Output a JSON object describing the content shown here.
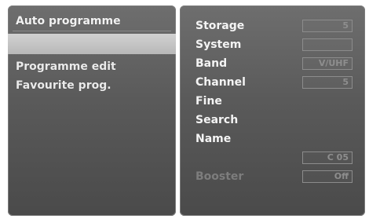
{
  "left_menu": {
    "header": "Auto programme",
    "selected": "",
    "items": [
      "Programme edit",
      "Favourite prog."
    ]
  },
  "right_menu": {
    "rows": [
      {
        "label": "Storage",
        "value": "5"
      },
      {
        "label": "System",
        "value": ""
      },
      {
        "label": "Band",
        "value": "V/UHF"
      },
      {
        "label": "Channel",
        "value": "5"
      },
      {
        "label": "Fine",
        "value": ""
      },
      {
        "label": "Search",
        "value": ""
      },
      {
        "label": "Name",
        "value": ""
      },
      {
        "label": "",
        "value": "C 05"
      },
      {
        "label": "Booster",
        "value": "Off"
      }
    ]
  }
}
